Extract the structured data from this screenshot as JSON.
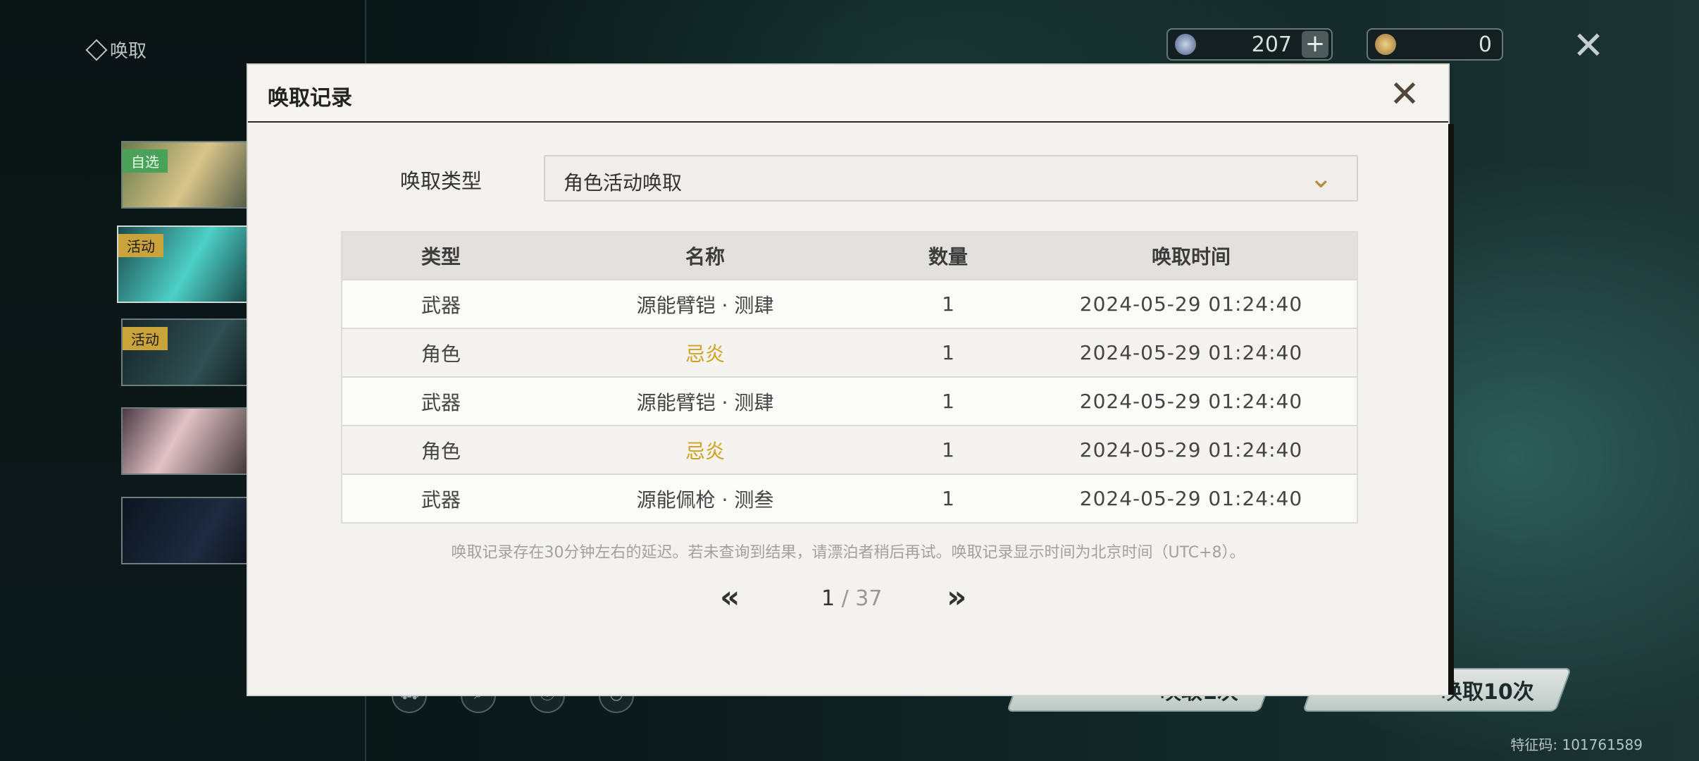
{
  "nav": {
    "title": "唤取"
  },
  "banners": [
    {
      "tag": "自选"
    },
    {
      "tag": "活动"
    },
    {
      "tag": "活动"
    },
    {
      "tag": ""
    },
    {
      "tag": ""
    }
  ],
  "resources": {
    "lunite": {
      "value": "207"
    },
    "coin": {
      "value": "0"
    },
    "plus": "+"
  },
  "pull_buttons": {
    "single": "唤取1次",
    "ten": "唤取10次"
  },
  "feature_code": "特征码: 101761589",
  "modal": {
    "title": "唤取记录",
    "type_label": "唤取类型",
    "selected_type": "角色活动唤取",
    "columns": [
      "类型",
      "名称",
      "数量",
      "唤取时间"
    ],
    "rows": [
      {
        "type": "武器",
        "name": "源能臂铠 · 测肆",
        "count": "1",
        "time": "2024-05-29 01:24:40"
      },
      {
        "type": "角色",
        "name": "忌炎",
        "count": "1",
        "time": "2024-05-29 01:24:40"
      },
      {
        "type": "武器",
        "name": "源能臂铠 · 测肆",
        "count": "1",
        "time": "2024-05-29 01:24:40"
      },
      {
        "type": "角色",
        "name": "忌炎",
        "count": "1",
        "time": "2024-05-29 01:24:40"
      },
      {
        "type": "武器",
        "name": "源能佩枪 · 测叁",
        "count": "1",
        "time": "2024-05-29 01:24:40"
      }
    ],
    "note": "唤取记录存在30分钟左右的延迟。若未查询到结果，请漂泊者稍后再试。唤取记录显示时间为北京时间（UTC+8）。",
    "pagination": {
      "current": "1",
      "separator": " / ",
      "total": "37",
      "prev": "«",
      "next": "»"
    }
  },
  "colors": {
    "highlight_name": "#d2a020",
    "accent_chevron": "#b88e45"
  }
}
